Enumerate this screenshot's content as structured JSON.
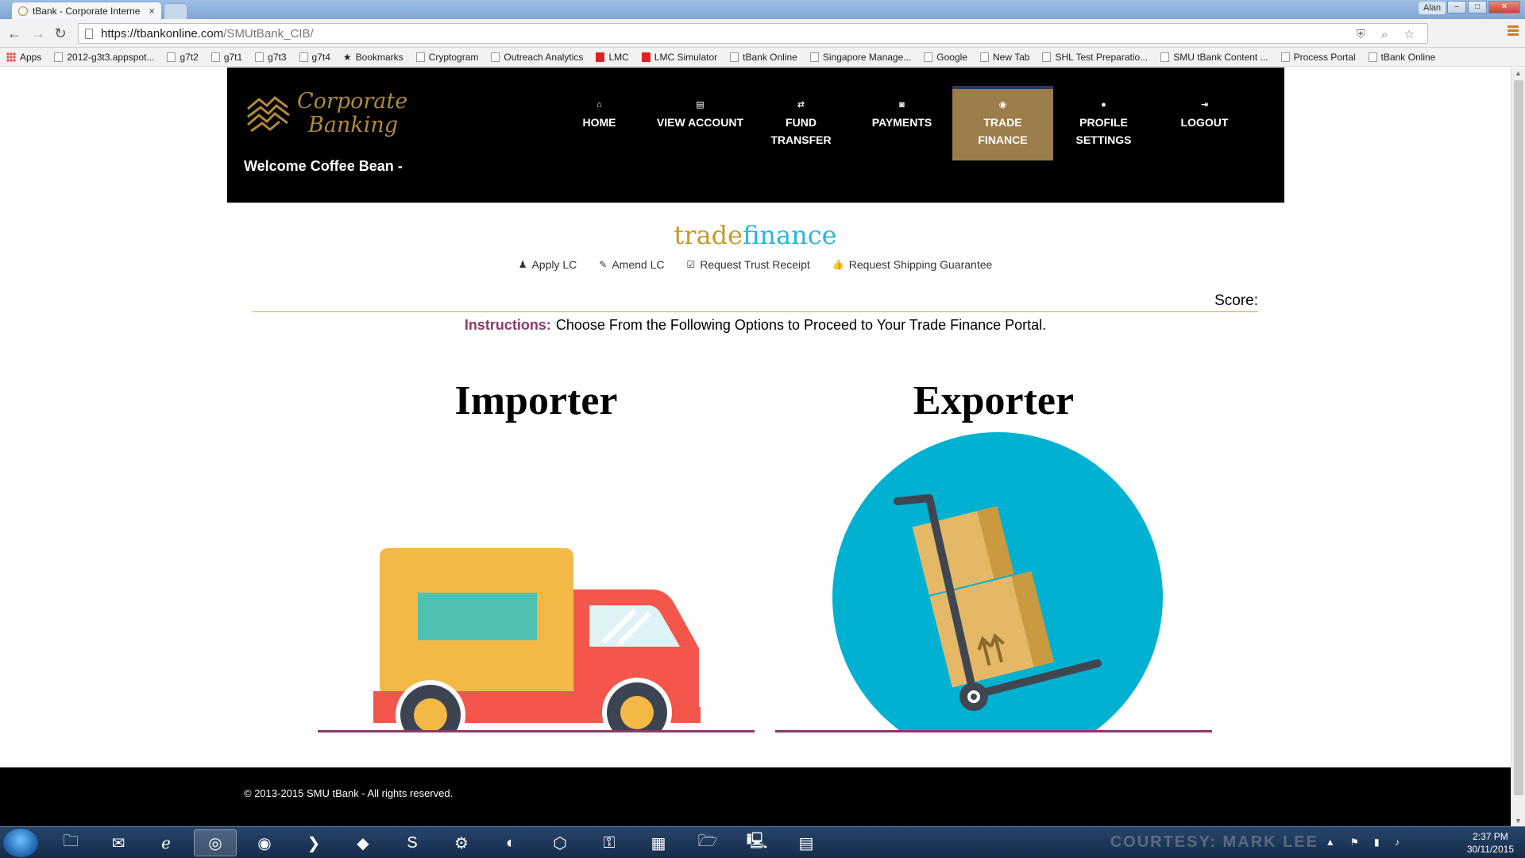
{
  "browser": {
    "tab_title": "tBank - Corporate Interne",
    "tab_close": "×",
    "user": "Alan",
    "url_host": "https://tbankonline.com",
    "url_path": "/SMUtBank_CIB/",
    "back": "←",
    "forward": "→",
    "reload": "↻",
    "omni_icons": "⛨ ⌕ ☆",
    "win_min": "–",
    "win_max": "□",
    "win_close": "✕"
  },
  "bookmarks": [
    {
      "label": "Apps",
      "icon": "apps"
    },
    {
      "label": "2012-g3t3.appspot...",
      "icon": "page"
    },
    {
      "label": "g7t2",
      "icon": "page"
    },
    {
      "label": "g7t1",
      "icon": "page"
    },
    {
      "label": "g7t3",
      "icon": "page"
    },
    {
      "label": "g7t4",
      "icon": "page"
    },
    {
      "label": "Bookmarks",
      "icon": "star"
    },
    {
      "label": "Cryptogram",
      "icon": "page"
    },
    {
      "label": "Outreach Analytics",
      "icon": "page"
    },
    {
      "label": "LMC",
      "icon": "red"
    },
    {
      "label": "LMC Simulator",
      "icon": "red"
    },
    {
      "label": "tBank Online",
      "icon": "page"
    },
    {
      "label": "Singapore Manage...",
      "icon": "page"
    },
    {
      "label": "Google",
      "icon": "page"
    },
    {
      "label": "New Tab",
      "icon": "page"
    },
    {
      "label": "SHL Test Preparatio...",
      "icon": "page"
    },
    {
      "label": "SMU tBank Content ...",
      "icon": "page"
    },
    {
      "label": "Process Portal",
      "icon": "page"
    },
    {
      "label": "tBank Online",
      "icon": "page"
    }
  ],
  "header": {
    "logo_line1": "Corporate",
    "logo_line2": "Banking",
    "welcome": "Welcome Coffee Bean -"
  },
  "nav": [
    {
      "label": "HOME",
      "icon": "⌂",
      "active": false
    },
    {
      "label": "VIEW ACCOUNT",
      "icon": "▤",
      "active": false
    },
    {
      "label": "FUND TRANSFER",
      "icon": "⇄",
      "active": false
    },
    {
      "label": "PAYMENTS",
      "icon": "◙",
      "active": false
    },
    {
      "label": "TRADE FINANCE",
      "icon": "◉",
      "active": true
    },
    {
      "label": "PROFILE SETTINGS",
      "icon": "●",
      "active": false
    },
    {
      "label": "LOGOUT",
      "icon": "⇥",
      "active": false
    }
  ],
  "section": {
    "title_part1": "trade",
    "title_part2": "finance"
  },
  "subnav": [
    {
      "label": "Apply LC",
      "icon": "♟"
    },
    {
      "label": "Amend LC",
      "icon": "✎"
    },
    {
      "label": "Request Trust Receipt",
      "icon": "☑"
    },
    {
      "label": "Request Shipping Guarantee",
      "icon": "👍"
    }
  ],
  "score": {
    "label": "Score:"
  },
  "instructions": {
    "label": "Instructions:",
    "text": "Choose From the Following Options to Proceed to Your Trade Finance Portal."
  },
  "options": {
    "importer": "Importer",
    "exporter": "Exporter"
  },
  "colors": {
    "gold": "#c59b28",
    "cyan": "#29b5de",
    "active_nav": "#9c7d4c",
    "instr_label": "#8b3a68",
    "circle": "#00b1d2"
  },
  "footer": {
    "copyright": "© 2013-2015 SMU tBank - All rights reserved."
  },
  "taskbar": {
    "time": "2:37 PM",
    "date": "30/11/2015",
    "watermark": "COURTESY: MARK LEE"
  }
}
